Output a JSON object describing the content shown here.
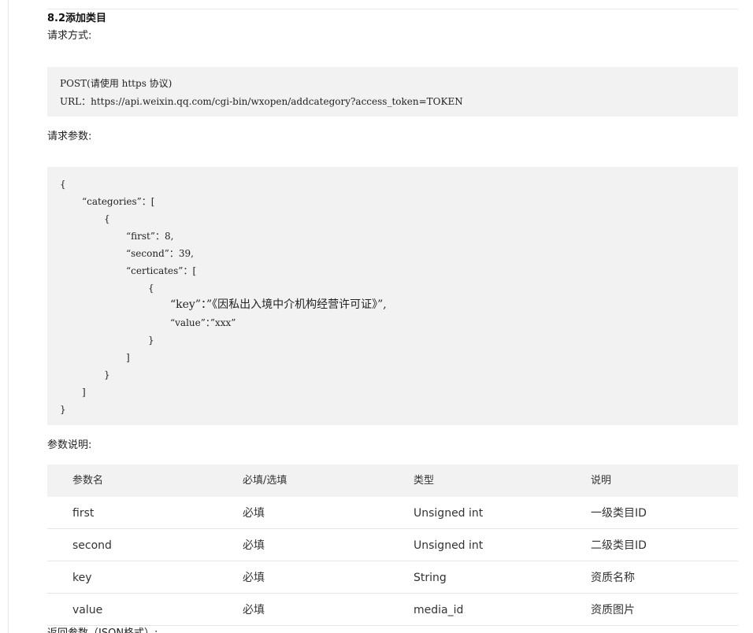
{
  "section": {
    "heading": "8.2添加类目",
    "request_method_label": "请求方式:",
    "request_params_label": "请求参数:",
    "param_desc_label": "参数说明:",
    "return_params_label": "返回参数（JSON格式）:"
  },
  "request_code": {
    "lines": [
      "POST(请使用 https 协议)",
      "URL：https://api.weixin.qq.com/cgi-bin/wxopen/addcategory?access_token=TOKEN"
    ]
  },
  "params_code": {
    "lines": [
      "{",
      "“categories”：[",
      "{",
      "“first”：8,",
      "“second”：39,",
      "“certicates”：[",
      "{",
      "“key”：”《因私出入境中介机构经营许可证》”,",
      "“value”：”xxx”",
      "}",
      "]",
      "}",
      "]",
      "}"
    ]
  },
  "table": {
    "headers": [
      "参数名",
      "必填/选填",
      "类型",
      "说明"
    ],
    "rows": [
      [
        "first",
        "必填",
        "Unsigned int",
        "一级类目ID"
      ],
      [
        "second",
        "必填",
        "Unsigned int",
        "二级类目ID"
      ],
      [
        "key",
        "必填",
        "String",
        "资质名称"
      ],
      [
        "value",
        "必填",
        "media_id",
        "资质图片"
      ]
    ]
  }
}
